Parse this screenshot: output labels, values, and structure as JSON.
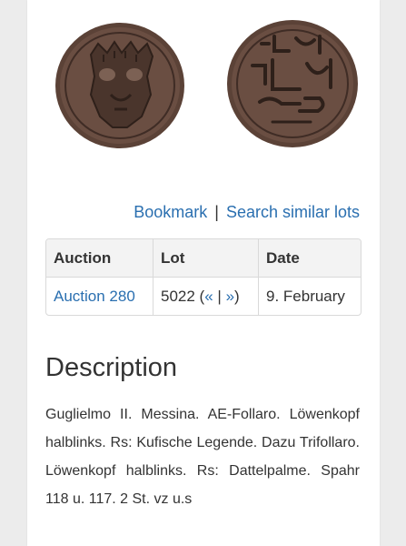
{
  "actions": {
    "bookmark_label": "Bookmark",
    "separator": "|",
    "search_similar_label": "Search similar lots"
  },
  "lots_table": {
    "headers": [
      "Auction",
      "Lot",
      "Date"
    ],
    "row": {
      "auction": "Auction 280",
      "lot_number": "5022",
      "nav_prefix": " (",
      "prev": "«",
      "nav_sep": " | ",
      "next": "»",
      "nav_suffix": ")",
      "date": "9. February"
    }
  },
  "description": {
    "heading": "Description",
    "text": "Guglielmo II. Messina. AE-Follaro. Löwenkopf halblinks. Rs: Kufische Legende. Dazu Trifollaro. Löwenkopf halblinks. Rs: Dattelpalme. Spahr 118 u. 117. 2 St. vz u.s"
  },
  "colors": {
    "link": "#2a6fb0",
    "coin": "#5b4237",
    "page_background": "#ececec"
  }
}
